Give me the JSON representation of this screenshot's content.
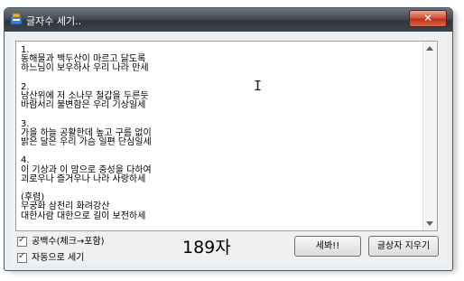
{
  "window": {
    "title": "글자수 세기..",
    "close_label": "✕"
  },
  "editor": {
    "text": "1.\n동해물과 백두산이 마르고 닳도록\n하느님이 보우하사 우리 나라 만세\n\n2.\n남산위에 저 소나무 철갑을 두른듯\n바람서리 불변함은 우리 기상일세\n\n3.\n가을 하늘 공활한데 높고 구름 없이\n밝은 달은 우리 가슴 일편 단심일세\n\n4.\n이 기상과 이 맘으로 충성을 다하여\n괴로우나 즐거우나 나라 사랑하세\n\n(후렴)\n무궁화 삼천리 화려강산\n대한사람 대한으로 길이 보전하세"
  },
  "options": {
    "include_spaces_label": "공백수(체크→포함)",
    "include_spaces_checked": true,
    "auto_count_label": "자동으로 세기",
    "auto_count_checked": true
  },
  "status": {
    "char_count": "189자"
  },
  "buttons": {
    "count_label": "세봐!!",
    "clear_label": "글상자 지우기"
  },
  "colors": {
    "title_bar": "#3d444b",
    "close_button": "#c0301a"
  }
}
